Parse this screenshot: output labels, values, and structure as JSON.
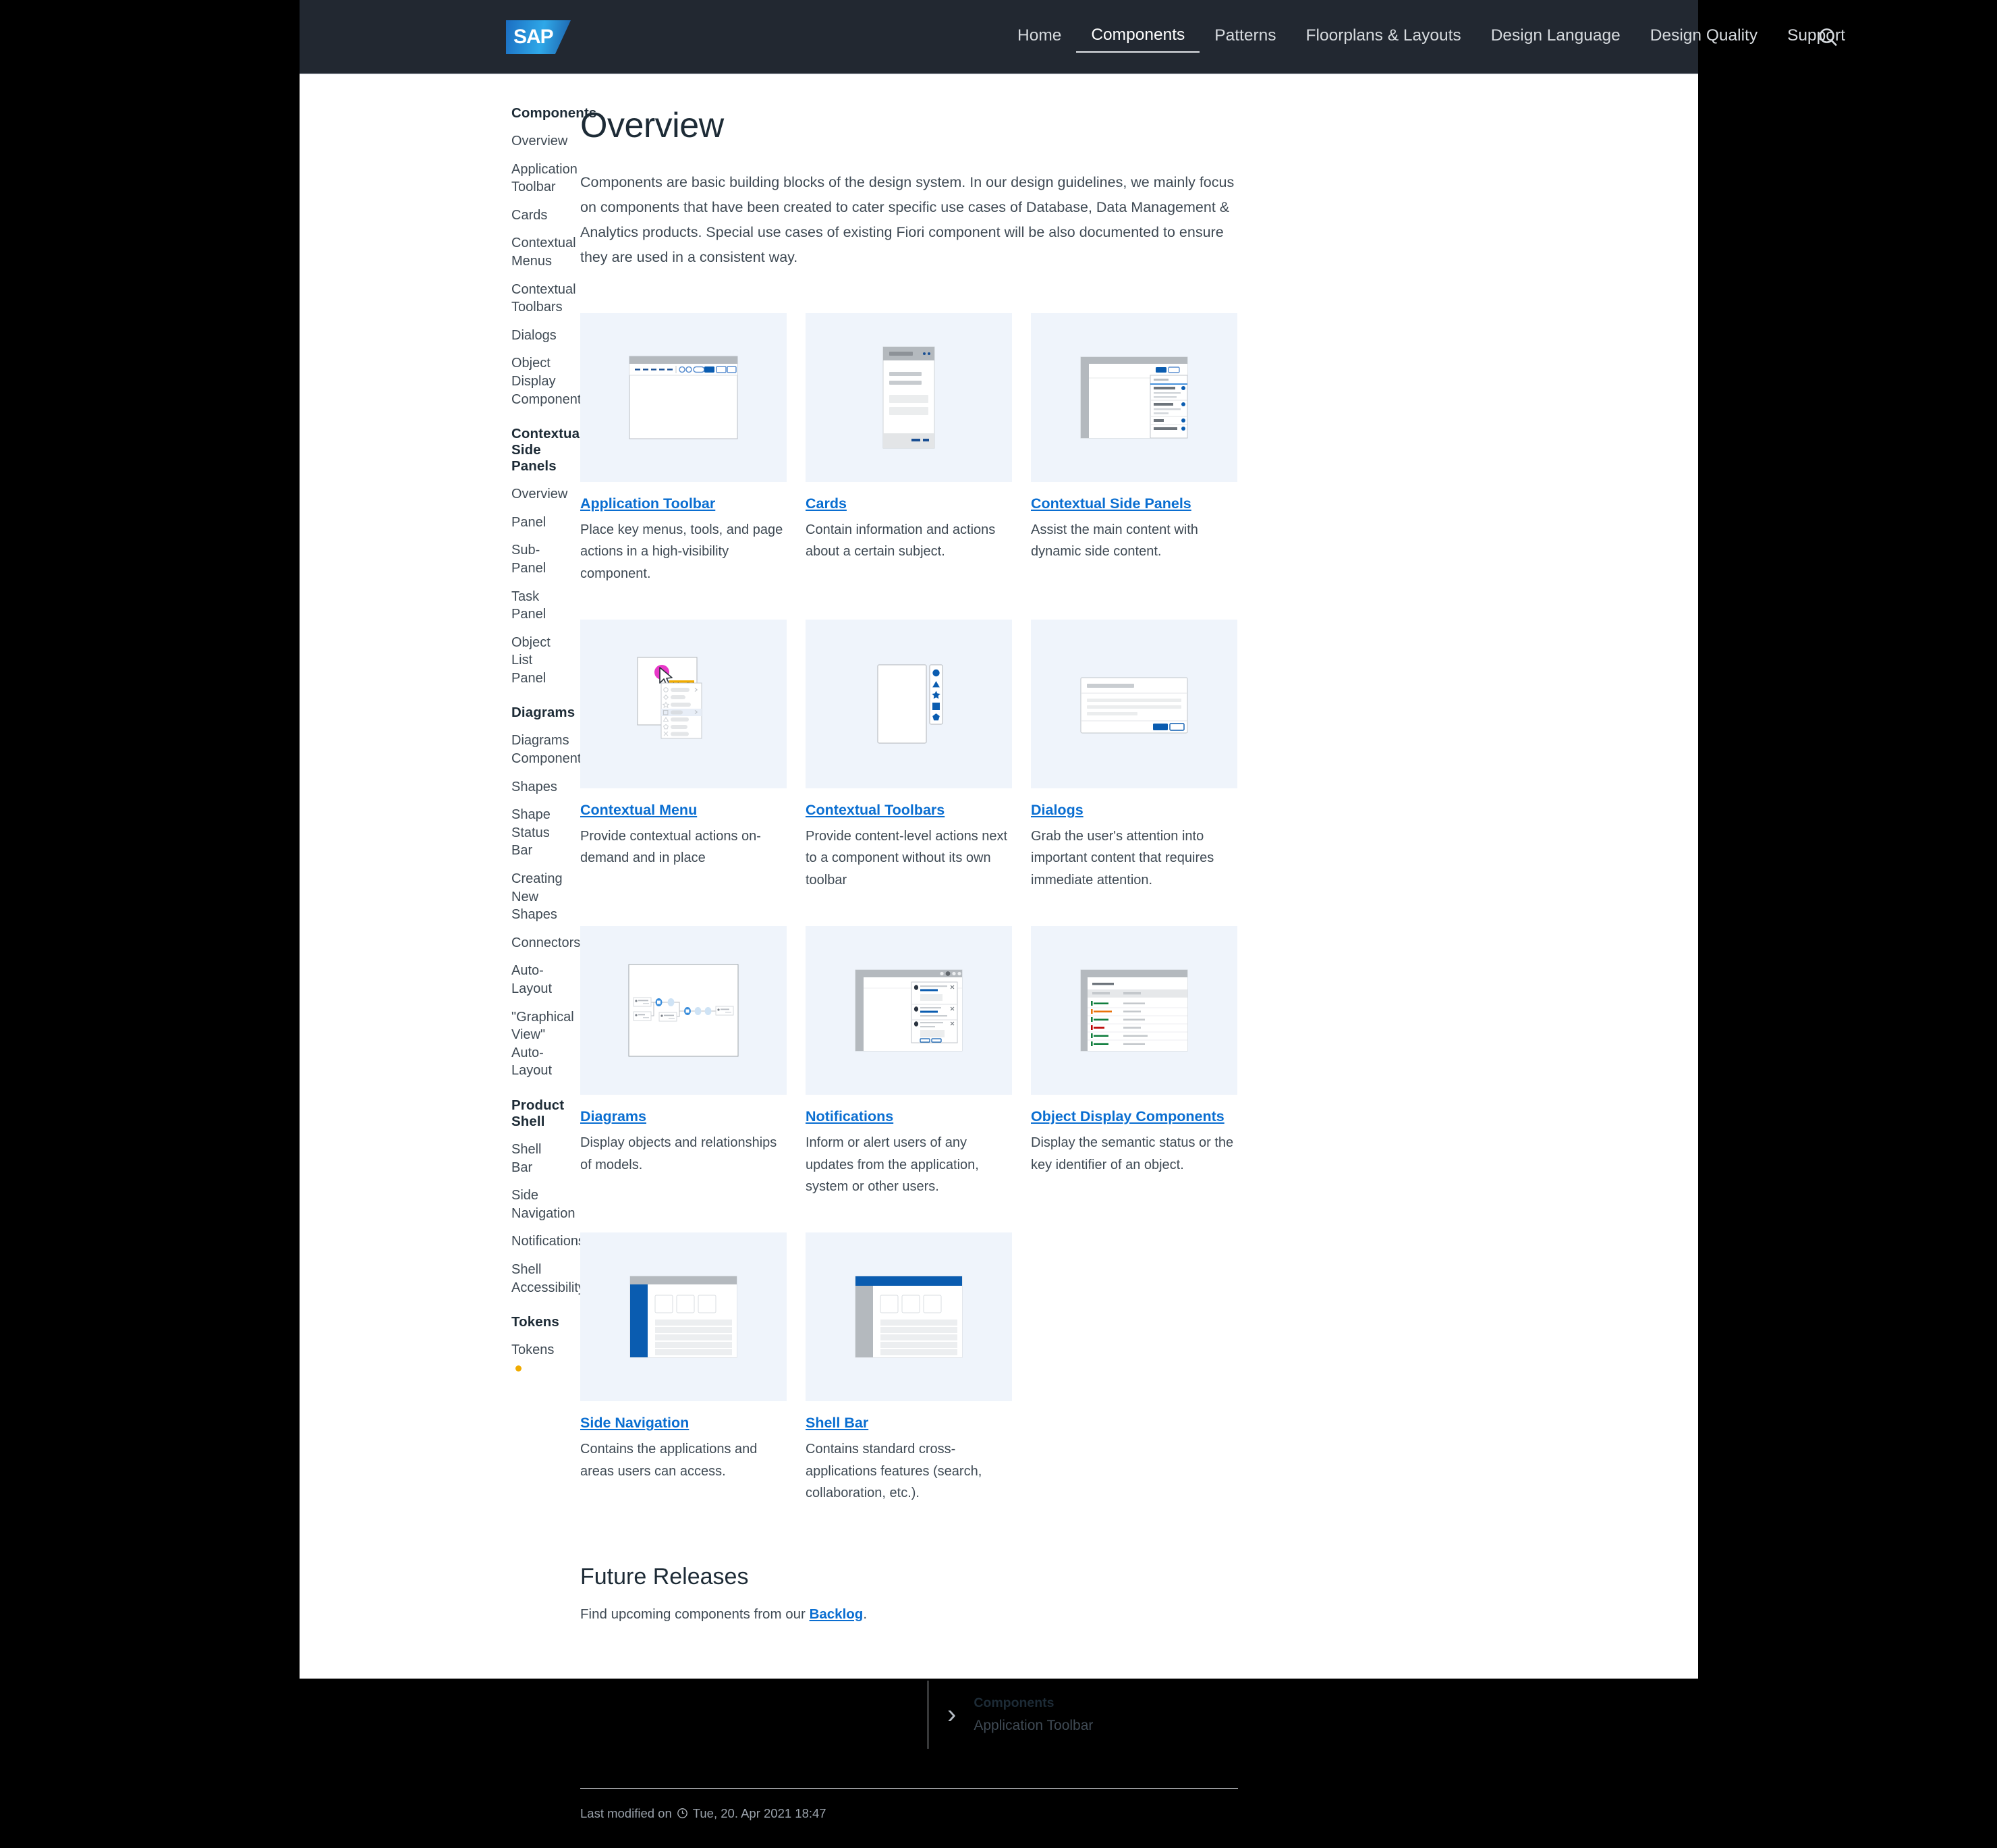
{
  "header": {
    "logo_text": "SAP",
    "nav": [
      {
        "label": "Home",
        "active": false
      },
      {
        "label": "Components",
        "active": true
      },
      {
        "label": "Patterns",
        "active": false
      },
      {
        "label": "Floorplans & Layouts",
        "active": false
      },
      {
        "label": "Design Language",
        "active": false
      },
      {
        "label": "Design Quality",
        "active": false
      },
      {
        "label": "Support",
        "active": false
      }
    ],
    "search_icon": "search-icon"
  },
  "sidebar": {
    "groups": [
      {
        "title": "Components",
        "items": [
          {
            "label": "Overview"
          },
          {
            "label": "Application Toolbar"
          },
          {
            "label": "Cards"
          },
          {
            "label": "Contextual Menus"
          },
          {
            "label": "Contextual Toolbars"
          },
          {
            "label": "Dialogs"
          },
          {
            "label": "Object Display Components"
          }
        ]
      },
      {
        "title": "Contextual Side Panels",
        "items": [
          {
            "label": "Overview"
          },
          {
            "label": "Panel"
          },
          {
            "label": "Sub-Panel"
          },
          {
            "label": "Task Panel"
          },
          {
            "label": "Object List Panel"
          }
        ]
      },
      {
        "title": "Diagrams",
        "items": [
          {
            "label": "Diagrams Component"
          },
          {
            "label": "Shapes"
          },
          {
            "label": "Shape Status Bar"
          },
          {
            "label": "Creating New Shapes"
          },
          {
            "label": "Connectors"
          },
          {
            "label": "Auto-Layout"
          },
          {
            "label": "\"Graphical View\" Auto-Layout"
          }
        ]
      },
      {
        "title": "Product Shell",
        "items": [
          {
            "label": "Shell Bar"
          },
          {
            "label": "Side Navigation"
          },
          {
            "label": "Notifications"
          },
          {
            "label": "Shell Accessibility"
          }
        ]
      },
      {
        "title": "Tokens",
        "items": [
          {
            "label": "Tokens",
            "badge": "new-dot"
          }
        ]
      }
    ]
  },
  "main": {
    "title": "Overview",
    "intro": "Components are basic building blocks of the design system. In our design guidelines, we mainly focus on components that have been created to cater specific use cases of Database, Data Management & Analytics products. Special use cases of existing Fiori component will be also documented to ensure they are used in a consistent way.",
    "cards": [
      {
        "link": "Application Toolbar",
        "desc": "Place key menus, tools, and page actions in a high-visibility component.",
        "art": "toolbar"
      },
      {
        "link": "Cards",
        "desc": "Contain information and actions about a certain subject.",
        "art": "cards"
      },
      {
        "link": "Contextual Side Panels",
        "desc": "Assist the main content with dynamic side content.",
        "art": "sidepanel"
      },
      {
        "link": "Contextual Menu",
        "desc": "Provide contextual actions on-demand and in place",
        "art": "ctxmenu",
        "badge": "right-click"
      },
      {
        "link": "Contextual Toolbars",
        "desc": "Provide content-level actions next to a component without its own toolbar",
        "art": "ctxtoolbar"
      },
      {
        "link": "Dialogs",
        "desc": "Grab the user's attention into important content that requires immediate attention.",
        "art": "dialog"
      },
      {
        "link": "Diagrams",
        "desc": "Display objects and relationships of models.",
        "art": "diagram"
      },
      {
        "link": "Notifications",
        "desc": "Inform or alert users of any updates from the application, system or other users.",
        "art": "notif"
      },
      {
        "link": "Object Display Components",
        "desc": "Display the semantic status or the key identifier of an object.",
        "art": "objdisp"
      },
      {
        "link": "Side Navigation",
        "desc": "Contains the applications and areas users can access.",
        "art": "sidenav"
      },
      {
        "link": "Shell Bar",
        "desc": "Contains standard cross-applications features (search, collaboration, etc.).",
        "art": "shellbar"
      }
    ],
    "future_releases": {
      "title": "Future Releases",
      "text_before": "Find upcoming components from our ",
      "link": "Backlog",
      "text_after": "."
    },
    "page_nav": {
      "chevron": "chevron-right-icon",
      "superscript": "Components",
      "label": "Application Toolbar"
    },
    "last_modified": {
      "prefix": "Last modified on",
      "icon": "clock-icon",
      "value": "Tue, 20. Apr 2021 18:47"
    }
  },
  "colors": {
    "header_bg": "#222831",
    "link_blue": "#0a6ed1",
    "thumb_bg": "#eff4fb",
    "accent_blue": "#0a5cb0",
    "badge_yellow": "#f0ab00",
    "status_green": "#107e3e",
    "status_orange": "#e9730c",
    "status_red": "#bb0000",
    "cursor_magenta": "#e838c8"
  }
}
